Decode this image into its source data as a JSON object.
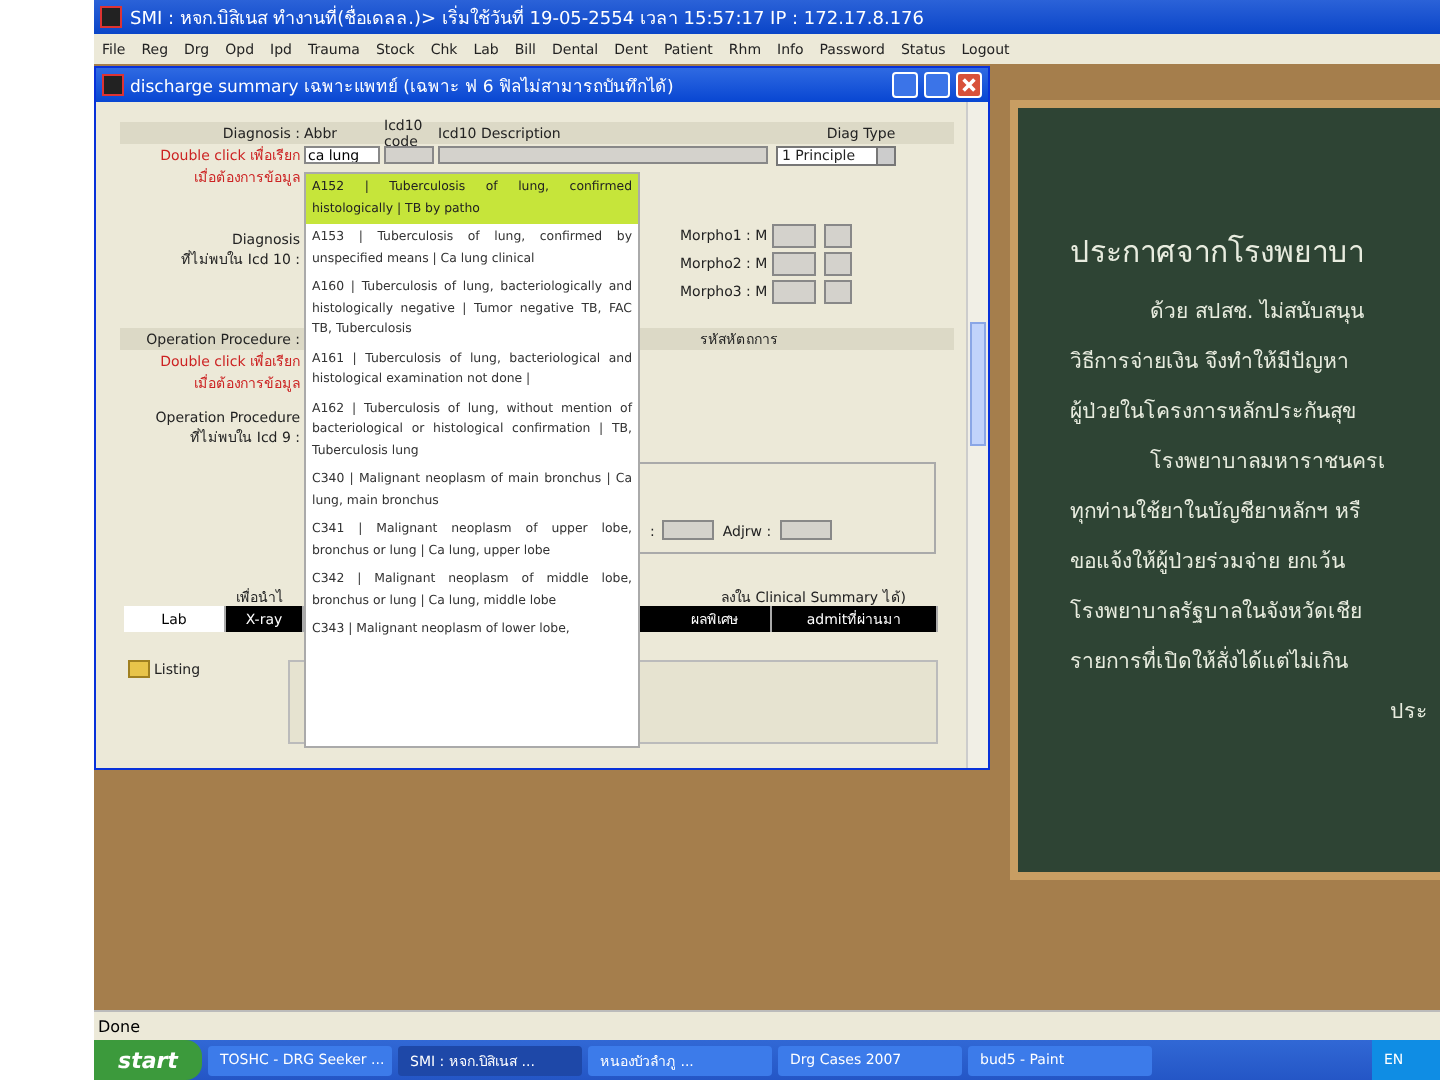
{
  "app_window": {
    "title": "SMI : หจก.บิสิเนส ทำงานที่(ชื่อเดลล.)> เริ่มใช้วันที่ 19-05-2554 เวลา 15:57:17 IP : 172.17.8.176",
    "menu": [
      "File",
      "Reg",
      "Drg",
      "Opd",
      "Ipd",
      "Trauma",
      "Stock",
      "Chk",
      "Lab",
      "Bill",
      "Dental",
      "Dent",
      "Patient",
      "Rhm",
      "Info",
      "Password",
      "Status",
      "Logout"
    ]
  },
  "dialog": {
    "title": "discharge summary เฉพาะแพทย์ (เฉพาะ ฟ 6 ฟิลไม่สามารถบันทึกได้)",
    "diagnosis": {
      "label": "Diagnosis :",
      "hint": "Double click เพื่อเรียก",
      "hint2": "เมื่อต้องการข้อมูล",
      "columns": [
        "Abbr",
        "Icd10 code",
        "Icd10 Description",
        "Diag Type"
      ],
      "abbr_value": "ca lung",
      "diag_type": "1 Principle"
    },
    "diagnosis_other": {
      "label": "Diagnosis",
      "label2": "ที่ไม่พบใน Icd 10 :",
      "morpho": [
        "Morpho1 : M",
        "Morpho2 : M",
        "Morpho3 : M"
      ]
    },
    "operation": {
      "label": "Operation Procedure :",
      "hint": "Double click เพื่อเรียก",
      "hint2": "เมื่อต้องการข้อมูล",
      "column": "รหัสหัตถการ"
    },
    "operation_other": {
      "label": "Operation Procedure",
      "label2": "ที่ไม่พบใน Icd 9 :"
    },
    "group": {
      "label": ":",
      "adjrw_label": "Adjrw :"
    },
    "note_left": "เพื่อนำไ",
    "note_right": "ลงใน Clinical Summary ได้)",
    "tabs": [
      {
        "label": "Lab",
        "selected": true
      },
      {
        "label": "X-ray",
        "selected": false
      },
      {
        "label": "ผลพิเศษ",
        "selected": false
      },
      {
        "label": "admitที่ผ่านมา",
        "selected": false
      }
    ],
    "tree_item": "Listing",
    "suggestions": [
      {
        "text": "A152 | Tuberculosis of lung, confirmed histologically | TB by patho",
        "selected": true
      },
      {
        "text": "A153 | Tuberculosis of lung, confirmed by unspecified means | Ca lung clinical",
        "selected": false
      },
      {
        "text": "A160 | Tuberculosis of lung, bacteriologically and histologically negative | Tumor negative TB, FAC TB, Tuberculosis",
        "selected": false
      },
      {
        "text": "A161 | Tuberculosis of lung, bacteriological and histological examination not done |",
        "selected": false
      },
      {
        "text": "A162 | Tuberculosis of lung, without mention of bacteriological or histological confirmation | TB, Tuberculosis lung",
        "selected": false
      },
      {
        "text": "C340 | Malignant neoplasm of main bronchus | Ca lung, main bronchus",
        "selected": false
      },
      {
        "text": "C341 | Malignant neoplasm of upper lobe, bronchus or lung | Ca lung, upper lobe",
        "selected": false
      },
      {
        "text": "C342 | Malignant neoplasm of middle lobe, bronchus or lung | Ca lung, middle lobe",
        "selected": false
      },
      {
        "text": "C343 | Malignant neoplasm of lower lobe,",
        "selected": false
      }
    ]
  },
  "board": {
    "title": "ประกาศจากโรงพยาบา",
    "lines": [
      {
        "text": "ด้วย สปสช. ไม่สนับสนุน",
        "kind": "indent"
      },
      {
        "text": "วิธีการจ่ายเงิน จึงทำให้มีปัญหา",
        "kind": "plain"
      },
      {
        "text": "ผู้ป่วยในโครงการหลักประกันสุข",
        "kind": "plain"
      },
      {
        "text": "โรงพยาบาลมหาราชนครเ",
        "kind": "indent"
      },
      {
        "text": "ทุกท่านใช้ยาในบัญชียาหลักฯ หรื",
        "kind": "plain"
      },
      {
        "text": "ขอแจ้งให้ผู้ป่วยร่วมจ่าย ยกเว้น",
        "kind": "plain"
      },
      {
        "text": "โรงพยาบาลรัฐบาลในจังหวัดเชีย",
        "kind": "plain"
      },
      {
        "text": "รายการที่เปิดให้สั่งได้แต่ไม่เกิน",
        "kind": "plain"
      },
      {
        "text": "ประ",
        "kind": "signature"
      }
    ]
  },
  "status_bar": "Done",
  "taskbar": {
    "start": "start",
    "tasks": [
      {
        "label": "TOSHC - DRG Seeker ...",
        "selected": false
      },
      {
        "label": "SMI : หจก.บิสิเนส ...",
        "selected": true
      },
      {
        "label": "หนองบัวลำภู ...",
        "selected": false
      },
      {
        "label": "Drg Cases 2007",
        "selected": false
      },
      {
        "label": "bud5 - Paint",
        "selected": false
      }
    ],
    "tray": "EN"
  }
}
